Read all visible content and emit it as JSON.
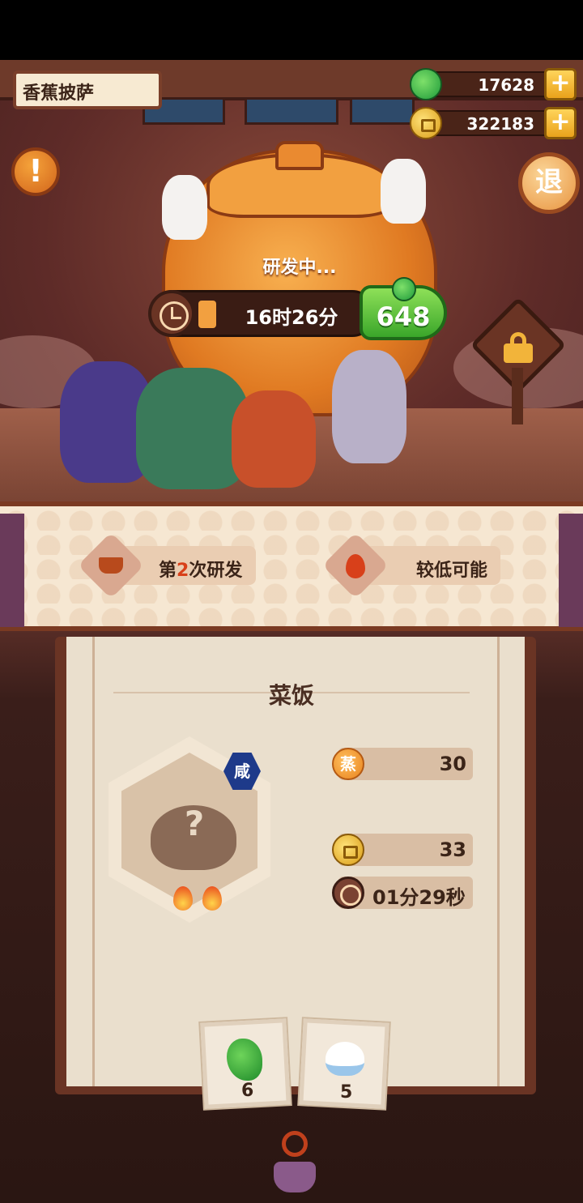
{
  "header": {
    "dish_name": "香蕉披萨"
  },
  "resources": {
    "jade": {
      "icon": "jade-icon",
      "value": "17628"
    },
    "coins": {
      "icon": "coin-icon",
      "value": "322183"
    },
    "add_symbol": "+"
  },
  "buttons": {
    "info_symbol": "!",
    "exit_label": "退"
  },
  "research": {
    "status": "研发中...",
    "time_left": "16时26分",
    "speedup_cost": "648"
  },
  "banner": {
    "attempt_prefix": "第",
    "attempt_number": "2",
    "attempt_suffix": "次研发",
    "probability": "较低可能"
  },
  "recipe": {
    "title": "菜饭",
    "flavor_badge": "咸",
    "steam_icon_label": "蒸",
    "steam_value": "30",
    "coin_value": "33",
    "cook_time": "01分29秒",
    "unknown_symbol": "?",
    "heat_level": 2,
    "ingredients": [
      {
        "icon": "bok-choy-icon",
        "count": "6"
      },
      {
        "icon": "rice-bowl-icon",
        "count": "5"
      }
    ]
  },
  "colors": {
    "accent_green": "#3aa62a",
    "accent_orange": "#e07a22",
    "highlight_red": "#d8401a"
  }
}
